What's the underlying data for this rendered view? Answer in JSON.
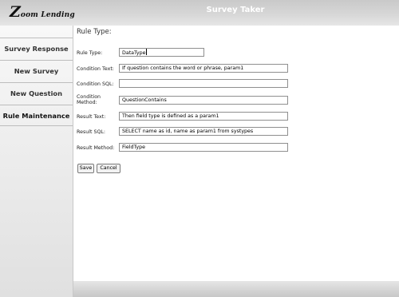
{
  "header": {
    "logo_initial": "Z",
    "logo_rest": "oom Lending",
    "title": "Survey Taker"
  },
  "sidebar": {
    "items": [
      {
        "label": "Survey Response"
      },
      {
        "label": "New Survey"
      },
      {
        "label": "New Question"
      },
      {
        "label": "Rule Maintenance",
        "active": true
      }
    ]
  },
  "form": {
    "title": "Rule Type:",
    "fields": {
      "rule_type": {
        "label": "Rule Type:",
        "value": "DataType"
      },
      "condition_text": {
        "label": "Condition Text:",
        "value": "If question contains the word or phrase, param1"
      },
      "condition_sql": {
        "label": "Condition SQL:",
        "value": ""
      },
      "condition_method": {
        "label_line1": "Condition",
        "label_line2": "Method:",
        "value": "QuestionContains"
      },
      "result_text": {
        "label": "Result Text:",
        "value": "Then field type is defined as a param1"
      },
      "result_sql": {
        "label": "Result SQL:",
        "value": "SELECT name as id, name as param1 from systypes"
      },
      "result_method": {
        "label": "Result Method:",
        "value": "FieldType"
      }
    },
    "buttons": {
      "save": "Save",
      "cancel": "Cancel"
    }
  }
}
